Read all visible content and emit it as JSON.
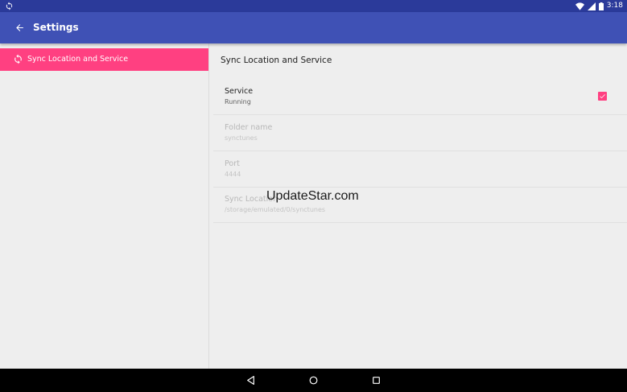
{
  "status_bar": {
    "time": "3:18",
    "icons": [
      "sync-icon",
      "wifi-icon",
      "signal-icon",
      "battery-icon"
    ]
  },
  "app_bar": {
    "title": "Settings",
    "back_icon": "arrow-left-icon"
  },
  "sidebar": {
    "items": [
      {
        "label": "Sync Location and Service",
        "icon": "sync-icon",
        "selected": true
      }
    ]
  },
  "content": {
    "heading": "Sync Location and Service",
    "preferences": [
      {
        "title": "Service",
        "summary": "Running",
        "enabled": true,
        "checked": true
      },
      {
        "title": "Folder name",
        "summary": "synctunes",
        "enabled": false
      },
      {
        "title": "Port",
        "summary": "4444",
        "enabled": false
      },
      {
        "title": "Sync Location",
        "summary": "/storage/emulated/0/synctunes",
        "enabled": false
      }
    ]
  },
  "watermark": "UpdateStar.com",
  "nav_bar": {
    "buttons": [
      "back-triangle-icon",
      "home-circle-icon",
      "recents-square-icon"
    ]
  },
  "colors": {
    "status_bar": "#2b3a9a",
    "app_bar": "#3f51b5",
    "accent": "#ff4081",
    "background": "#eeeeee"
  }
}
